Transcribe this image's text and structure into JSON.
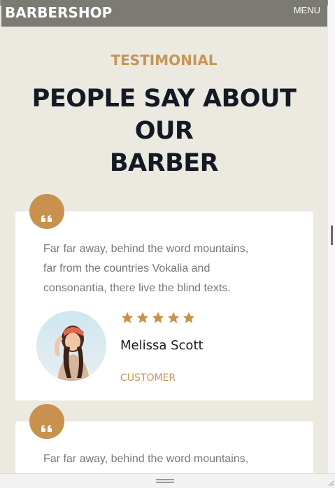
{
  "navbar": {
    "brand": "BARBERSHOP",
    "menu_label": "MENU"
  },
  "section": {
    "eyebrow": "TESTIMONIAL",
    "heading_line1": "PEOPLE SAY ABOUT OUR",
    "heading_line2": "BARBER"
  },
  "testimonials": [
    {
      "quote_line1": "Far far away, behind the word mountains,",
      "quote_line2": "far from the countries Vokalia and",
      "quote_line3": "consonantia, there live the blind texts.",
      "rating": 5,
      "name": "Melissa Scott",
      "role": "CUSTOMER"
    },
    {
      "quote_line1": "Far far away, behind the word mountains,"
    }
  ],
  "colors": {
    "accent": "#c8914d",
    "background": "#ece9e0",
    "heading": "#141a24",
    "navbar": "#7b7a73"
  },
  "icons": {
    "quote": "quote-icon",
    "star": "star-icon",
    "menu": "menu-icon"
  }
}
